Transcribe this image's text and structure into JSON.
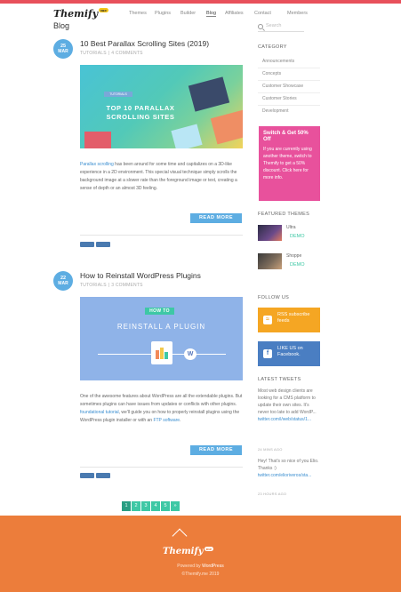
{
  "header": {
    "logo": "Themify",
    "logo_badge": "me",
    "nav": [
      "Themes",
      "Plugins",
      "Builder",
      "Blog",
      "Affiliates",
      "Contact",
      "Members"
    ],
    "active_nav": "Blog",
    "search_placeholder": "Search"
  },
  "page_title": "Blog",
  "posts": [
    {
      "day": "25",
      "month": "MAR",
      "title": "10 Best Parallax Scrolling Sites (2019)",
      "category": "TUTORIALS",
      "comments": "4 COMMENTS",
      "image": {
        "tag": "TUTORIALS",
        "banner_line1": "TOP 10 PARALLAX",
        "banner_line2": "SCROLLING SITES"
      },
      "excerpt_link": "Parallax scrolling",
      "excerpt": " has been around for some time and capitalizes on a 3D-like experience in a 2D environment. This special visual technique simply scrolls the background image at a slower rate than the foreground image or text, creating a sense of depth or an almost 3D feeling.",
      "read_more": "READ MORE"
    },
    {
      "day": "22",
      "month": "MAR",
      "title": "How to Reinstall WordPress Plugins",
      "category": "TUTORIALS",
      "comments": "3 COMMENTS",
      "image": {
        "tag": "HOW TO",
        "banner": "REINSTALL A PLUGIN",
        "plug_label": "W"
      },
      "excerpt_pre": "One of the awesome features about WordPress are all the extendable plugins. But sometimes plugins can have issues from updates or conflicts with other plugins. ",
      "excerpt_link1": "foundational tutorial",
      "excerpt_mid": ", we'll guide you on how to properly reinstall plugins using the WordPress plugin installer or with an ",
      "excerpt_link2": "FTP software",
      "excerpt_post": ".",
      "read_more": "READ MORE"
    }
  ],
  "pagination": {
    "pages": [
      "1",
      "2",
      "3",
      "4",
      "5"
    ],
    "current": "1",
    "next": "»"
  },
  "sidebar": {
    "category_title": "CATEGORY",
    "categories": [
      "Announcements",
      "Concepts",
      "Customer Showcase",
      "Customer Stories",
      "Development"
    ],
    "promo": {
      "title": "Switch & Get 50% Off",
      "text": "If you are currently using another theme, switch to Themify to get a 50% discount. Click here for more info."
    },
    "featured_title": "FEATURED THEMES",
    "themes": [
      {
        "name": "Ultra",
        "demo": "DEMO"
      },
      {
        "name": "Shoppe",
        "demo": "DEMO"
      }
    ],
    "follow_title": "FOLLOW US",
    "rss_label": "RSS subscribe feeds",
    "facebook_label": "LIKE US on Facebook.",
    "tweets_title": "LATEST TWEETS",
    "tweets": [
      {
        "text": "Most web design clients are looking for a CMS platform to update their own sites. It's never too late to add WordP... ",
        "link": "twitter.com/i/web/status/1...",
        "time": "24 MINS AGO"
      },
      {
        "text": "Hey! That's so nice of you Elio. Thanks :) ",
        "link": "twitter.com/elioriveros/sta...",
        "time": "23 HOURS AGO"
      }
    ]
  },
  "footer": {
    "logo": "Themify",
    "logo_badge": "me",
    "powered_by": "Powered by",
    "powered_link": "WordPress",
    "copyright": "©Themify.me 2019"
  },
  "colors": {
    "accent_blue": "#5dade2",
    "accent_green": "#3ec8a5",
    "promo_pink": "#e8519c",
    "rss_orange": "#f5a623",
    "facebook_blue": "#4a7ec2",
    "footer_orange": "#ec7d3b",
    "topbar_red": "#e8505b"
  }
}
